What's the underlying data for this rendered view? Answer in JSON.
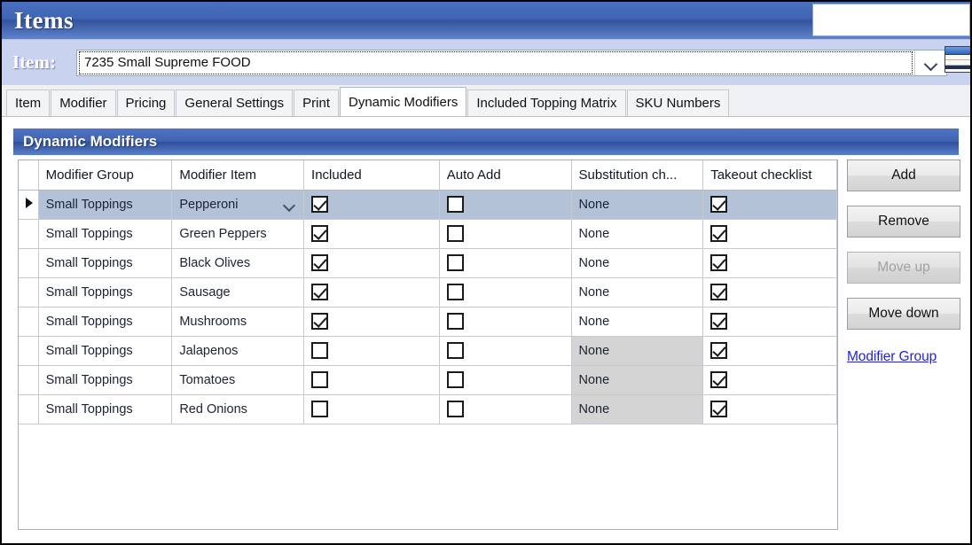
{
  "window": {
    "title": "Items",
    "titlebar_blank": ""
  },
  "item_bar": {
    "label": "Item:",
    "value": "7235 Small Supreme FOOD",
    "placeholder": "",
    "dropdown_icon": "chevron-down-icon",
    "grid_icon": "grid-window-icon"
  },
  "tabs": [
    {
      "label": "Item",
      "active": false
    },
    {
      "label": "Modifier",
      "active": false
    },
    {
      "label": "Pricing",
      "active": false
    },
    {
      "label": "General Settings",
      "active": false
    },
    {
      "label": "Print",
      "active": false
    },
    {
      "label": "Dynamic Modifiers",
      "active": true
    },
    {
      "label": "Included Topping Matrix",
      "active": false
    },
    {
      "label": "SKU Numbers",
      "active": false
    }
  ],
  "group_box": {
    "title": "Dynamic Modifiers"
  },
  "grid": {
    "columns": [
      "Modifier Group",
      "Modifier Item",
      "Included",
      "Auto Add",
      "Substitution ch...",
      "Takeout checklist"
    ],
    "rows": [
      {
        "selected": true,
        "marker": true,
        "modifier_group": "Small Toppings",
        "modifier_item": "Pepperoni",
        "has_dropdown": true,
        "included": true,
        "auto_add": false,
        "substitution": "None",
        "substitution_disabled": false,
        "takeout": true
      },
      {
        "selected": false,
        "marker": false,
        "modifier_group": "Small Toppings",
        "modifier_item": "Green Peppers",
        "has_dropdown": false,
        "included": true,
        "auto_add": false,
        "substitution": "None",
        "substitution_disabled": false,
        "takeout": true
      },
      {
        "selected": false,
        "marker": false,
        "modifier_group": "Small Toppings",
        "modifier_item": "Black Olives",
        "has_dropdown": false,
        "included": true,
        "auto_add": false,
        "substitution": "None",
        "substitution_disabled": false,
        "takeout": true
      },
      {
        "selected": false,
        "marker": false,
        "modifier_group": "Small Toppings",
        "modifier_item": "Sausage",
        "has_dropdown": false,
        "included": true,
        "auto_add": false,
        "substitution": "None",
        "substitution_disabled": false,
        "takeout": true
      },
      {
        "selected": false,
        "marker": false,
        "modifier_group": "Small Toppings",
        "modifier_item": "Mushrooms",
        "has_dropdown": false,
        "included": true,
        "auto_add": false,
        "substitution": "None",
        "substitution_disabled": false,
        "takeout": true
      },
      {
        "selected": false,
        "marker": false,
        "modifier_group": "Small Toppings",
        "modifier_item": "Jalapenos",
        "has_dropdown": false,
        "included": false,
        "auto_add": false,
        "substitution": "None",
        "substitution_disabled": true,
        "takeout": true
      },
      {
        "selected": false,
        "marker": false,
        "modifier_group": "Small Toppings",
        "modifier_item": "Tomatoes",
        "has_dropdown": false,
        "included": false,
        "auto_add": false,
        "substitution": "None",
        "substitution_disabled": true,
        "takeout": true
      },
      {
        "selected": false,
        "marker": false,
        "modifier_group": "Small Toppings",
        "modifier_item": "Red Onions",
        "has_dropdown": false,
        "included": false,
        "auto_add": false,
        "substitution": "None",
        "substitution_disabled": true,
        "takeout": true
      }
    ]
  },
  "side_buttons": [
    {
      "label": "Add",
      "disabled": false
    },
    {
      "label": "Remove",
      "disabled": false
    },
    {
      "label": "Move up",
      "disabled": true
    },
    {
      "label": "Move down",
      "disabled": false
    }
  ],
  "side_link": {
    "label": "Modifier Group"
  },
  "colors": {
    "titlebar_blue": "#3f63b3",
    "itembar_lavender": "#c9d2ee",
    "selected_row": "#b4c2d7",
    "disabled_cell": "#d4d4d4",
    "link_blue": "#2222dd",
    "grid_border": "#c6c9ce"
  }
}
